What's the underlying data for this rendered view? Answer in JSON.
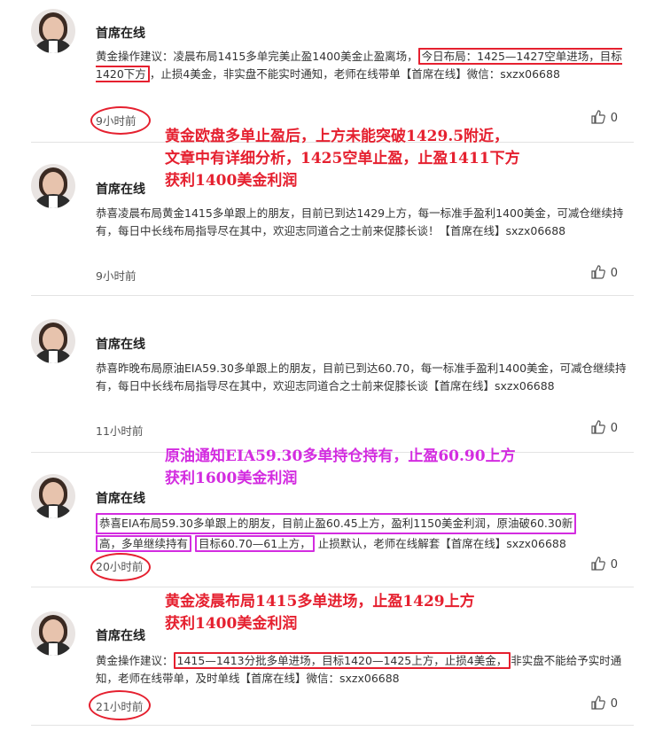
{
  "like_count": "0",
  "posts": [
    {
      "author": "首席在线",
      "content_a": "黄金操作建议：凌晨布局1415多单完美止盈1400美金止盈离场，",
      "content_hl": "今日布局：1425—1427空单进场，目标1420下方",
      "content_b": "，止损4美金，非实盘不能实时通知，老师在线带单【首席在线】微信：sxzx06688",
      "time": "9小时前"
    },
    {
      "author": "首席在线",
      "content": "恭喜凌晨布局黄金1415多单跟上的朋友，目前已到达1429上方，每一标准手盈利1400美金，可减仓继续持有，每日中长线布局指导尽在其中，欢迎志同道合之士前来促膝长谈！【首席在线】sxzx06688",
      "time": "9小时前"
    },
    {
      "author": "首席在线",
      "content": "恭喜昨晚布局原油EIA59.30多单跟上的朋友，目前已到达60.70，每一标准手盈利1400美金，可减仓继续持有，每日中长线布局指导尽在其中，欢迎志同道合之士前来促膝长谈【首席在线】sxzx06688",
      "time": "11小时前"
    },
    {
      "author": "首席在线",
      "content_line1": "恭喜EIA布局59.30多单跟上的朋友，目前止盈60.45上方，盈利1150美金利润，原油破60.30新",
      "content_hl1": "高，多单继续持有",
      "content_hl2": "目标60.70—61上方，",
      "content_b": "止损默认，老师在线解套【首席在线】sxzx06688",
      "time": "20小时前"
    },
    {
      "author": "首席在线",
      "content_a": "黄金操作建议：",
      "content_hl": "1415—1413分批多单进场，目标1420—1425上方，止损4美金，",
      "content_b": "非实盘不能给予实时通知，老师在线带单，及时单线【首席在线】微信：sxzx06688",
      "time": "21小时前"
    }
  ],
  "annotations": {
    "note1_line1": "黄金欧盘多单止盈后，上方未能突破1429.5附近，",
    "note1_line2": "文章中有详细分析，1425空单止盈，止盈1411下方",
    "note1_line3": "获利1400美金利润",
    "note2_line1": "原油通知EIA59.30多单持仓持有，止盈60.90上方",
    "note2_line2": "获利1600美金利润",
    "note3_line1": "黄金凌晨布局1415多单进场，止盈1429上方",
    "note3_line2": "获利1400美金利润"
  }
}
